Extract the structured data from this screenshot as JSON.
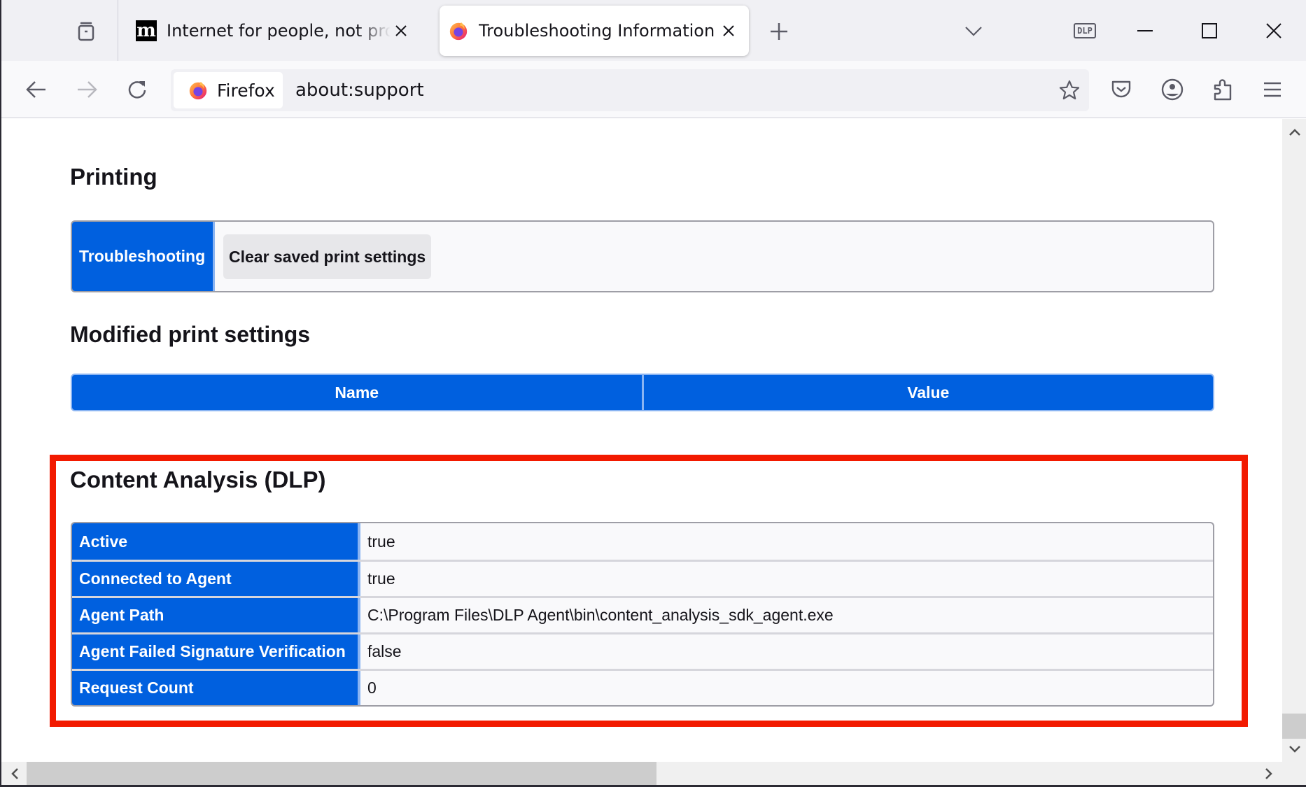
{
  "window": {
    "tabs": [
      {
        "title": "Internet for people, not profit — Mozilla",
        "favicon": "mozilla-m-logo",
        "active": false
      },
      {
        "title": "Troubleshooting Information",
        "favicon": "firefox-logo",
        "active": true
      }
    ],
    "toolbar_badge": "DLP"
  },
  "navbar": {
    "identity_label": "Firefox",
    "url": "about:support"
  },
  "page": {
    "printing": {
      "heading": "Printing",
      "troubleshooting_label": "Troubleshooting",
      "clear_button": "Clear saved print settings"
    },
    "modified_print_settings": {
      "heading": "Modified print settings",
      "columns": [
        "Name",
        "Value"
      ]
    },
    "content_analysis": {
      "heading": "Content Analysis (DLP)",
      "rows": [
        {
          "label": "Active",
          "value": "true"
        },
        {
          "label": "Connected to Agent",
          "value": "true"
        },
        {
          "label": "Agent Path",
          "value": "C:\\Program Files\\DLP Agent\\bin\\content_analysis_sdk_agent.exe"
        },
        {
          "label": "Agent Failed Signature Verification",
          "value": "false"
        },
        {
          "label": "Request Count",
          "value": "0"
        }
      ]
    }
  },
  "colors": {
    "accent": "#0060df",
    "highlight": "#f21a00"
  }
}
